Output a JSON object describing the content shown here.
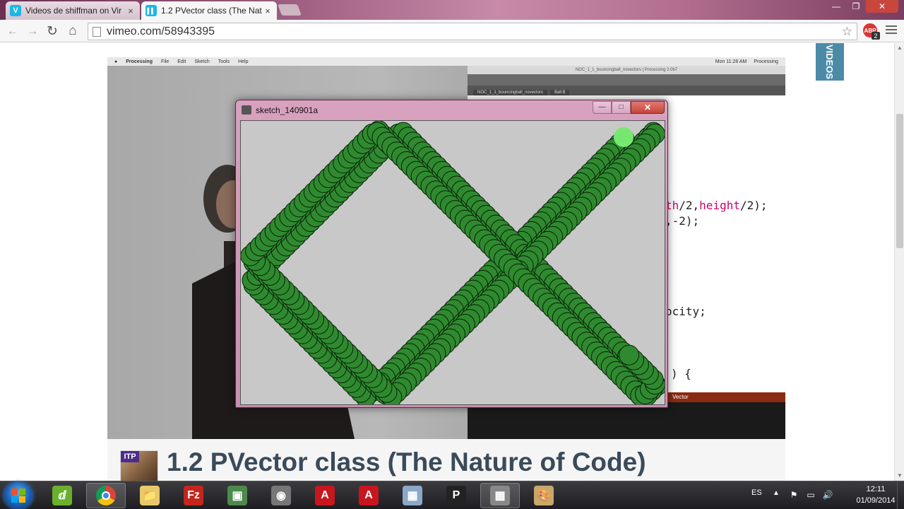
{
  "browser": {
    "tabs": [
      {
        "title": "Videos de shiffman on Vir",
        "close": "×",
        "favicon_color": "#1ab7ea",
        "favicon": "V"
      },
      {
        "title": "1.2 PVector class (The Nat",
        "close": "×",
        "favicon_color": "#1ab7ea",
        "favicon": "▌▌"
      }
    ],
    "window_controls": {
      "minimize": "—",
      "maximize": "❐",
      "close": "✕"
    },
    "toolbar": {
      "back": "←",
      "forward": "→",
      "reload": "↻",
      "home": "⌂",
      "star": "☆",
      "abp_label": "ABP",
      "abp_count": "2"
    },
    "address": "vimeo.com/58943395"
  },
  "page": {
    "side_tab": "VIDEOS",
    "video_frame": {
      "mac_menu": [
        "Processing",
        "File",
        "Edit",
        "Sketch",
        "Tools",
        "Help"
      ],
      "mac_menu_right": [
        "Mon 11:28 AM",
        "Processing"
      ],
      "ide_title": "NOC_1_1_bouncingball_novectors | Processing 2.0b7",
      "ide_tabs": [
        "NOC_1_1_bouncingball_novectors",
        "Ball $"
      ],
      "code_lines": [
        {
          "pre": "",
          "kw": "th",
          "post": "/2,",
          "kw2": "height",
          "post2": "/2);"
        },
        {
          "pre": ",-2);",
          "kw": "",
          "post": "",
          "kw2": "",
          "post2": ""
        },
        {
          "pre": "ocity;",
          "kw": "",
          "post": "",
          "kw2": "",
          "post2": ""
        },
        {
          "pre": ") {",
          "kw": "",
          "post": "",
          "kw2": "",
          "post2": ""
        },
        {
          "pre": ") {",
          "kw": "",
          "post": "",
          "kw2": "",
          "post2": ""
        }
      ],
      "console_label": "Vector"
    },
    "sketch_window": {
      "title": "sketch_140901a",
      "min": "—",
      "max": "□",
      "close": "✕",
      "background": "#c8c8c8",
      "ball_color": "#77e86f",
      "trail_color": "#2f8a2f"
    },
    "video_title": "1.2 PVector class (The Nature of Code)",
    "channel_badge": "ITP"
  },
  "taskbar": {
    "apps": [
      {
        "name": "dreamweaver",
        "glyph": "ⅆ",
        "color": "#6ab02e",
        "active": false
      },
      {
        "name": "chrome",
        "glyph": "",
        "color": "#e8e8e8",
        "active": true
      },
      {
        "name": "explorer",
        "glyph": "📁",
        "color": "#e8c86a",
        "active": false
      },
      {
        "name": "filezilla",
        "glyph": "Fz",
        "color": "#c4251c",
        "active": false
      },
      {
        "name": "monitor",
        "glyph": "▣",
        "color": "#4c8a4c",
        "active": false
      },
      {
        "name": "media",
        "glyph": "◉",
        "color": "#777",
        "active": false
      },
      {
        "name": "autocad-1",
        "glyph": "A",
        "color": "#c8161e",
        "active": false
      },
      {
        "name": "autocad-2",
        "glyph": "A",
        "color": "#c8161e",
        "active": false
      },
      {
        "name": "calculator",
        "glyph": "▦",
        "color": "#8aa8c8",
        "active": false
      },
      {
        "name": "processing",
        "glyph": "P",
        "color": "#222",
        "active": false
      },
      {
        "name": "app-window",
        "glyph": "▩",
        "color": "#888",
        "active": true
      },
      {
        "name": "paint",
        "glyph": "🎨",
        "color": "#c8a86a",
        "active": false
      }
    ],
    "language": "ES",
    "clock_time": "12:11",
    "clock_date": "01/09/2014"
  }
}
